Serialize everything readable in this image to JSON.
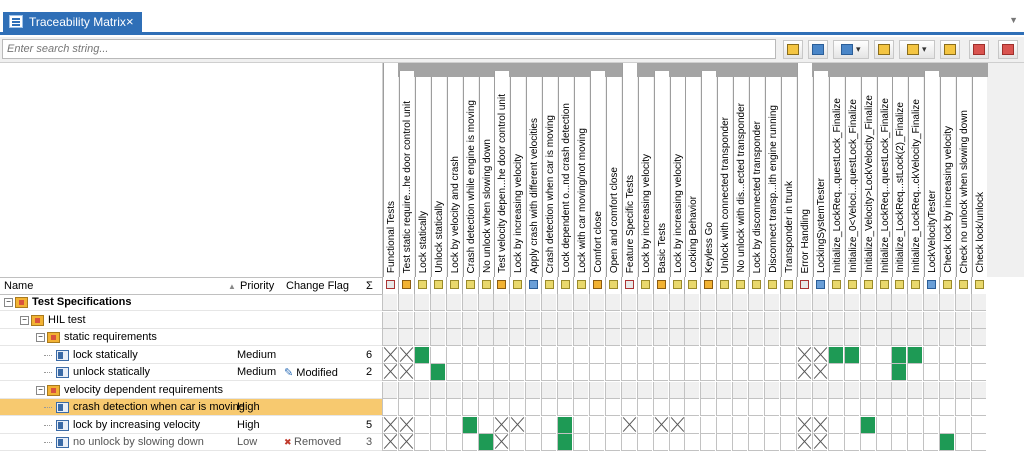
{
  "tab": {
    "title": "Traceability Matrix",
    "close": "×",
    "menu": "▼"
  },
  "search": {
    "placeholder": "Enter search string..."
  },
  "toolbar": [
    {
      "name": "search-next-button",
      "icon": "search-forward-icon"
    },
    {
      "name": "search-prev-button",
      "icon": "search-back-icon"
    },
    {
      "name": "filter-dropdown-button",
      "icon": "filter-icon"
    },
    {
      "name": "filter-apply-button",
      "icon": "filter-apply-icon"
    },
    {
      "name": "view-dropdown-button",
      "icon": "view-icon"
    },
    {
      "name": "export-button",
      "icon": "export-icon"
    },
    {
      "name": "link-button",
      "icon": "link-icon"
    },
    {
      "name": "unlink-button",
      "icon": "unlink-icon"
    }
  ],
  "columns_header": {
    "name": "Name",
    "sort_indicator": "▲",
    "priority": "Priority",
    "change_flag": "Change Flag",
    "sigma": "Σ"
  },
  "columns": [
    {
      "label": "Functional Tests",
      "kind": "group"
    },
    {
      "label": "Test static require...he door control unit",
      "kind": "sub"
    },
    {
      "label": "Lock statically",
      "kind": "item"
    },
    {
      "label": "Unlock statically",
      "kind": "item"
    },
    {
      "label": "Lock by velocity and crash",
      "kind": "item"
    },
    {
      "label": "Crash detection while engine is moving",
      "kind": "item"
    },
    {
      "label": "No unlock when slowing down",
      "kind": "item"
    },
    {
      "label": "Test velocity depen...he door control unit",
      "kind": "sub"
    },
    {
      "label": "Lock by increasing velocity",
      "kind": "item"
    },
    {
      "label": "Apply crash with different velocities",
      "kind": "item"
    },
    {
      "label": "Crash detection when car is moving",
      "kind": "item"
    },
    {
      "label": "Lock dependent o...nd crash detection",
      "kind": "item"
    },
    {
      "label": "Lock with car moving/not moving",
      "kind": "item"
    },
    {
      "label": "Comfort close",
      "kind": "sub"
    },
    {
      "label": "Open and comfort close",
      "kind": "item"
    },
    {
      "label": "Feature Specific Tests",
      "kind": "group"
    },
    {
      "label": "Lock by increasing velocity",
      "kind": "item"
    },
    {
      "label": "Basic Tests",
      "kind": "sub"
    },
    {
      "label": "Lock by increasing velocity",
      "kind": "item"
    },
    {
      "label": "Locking Behavior",
      "kind": "item"
    },
    {
      "label": "Keyless Go",
      "kind": "sub"
    },
    {
      "label": "Unlock with connected transponder",
      "kind": "item"
    },
    {
      "label": "No unlock with dis...ected transponder",
      "kind": "item"
    },
    {
      "label": "Lock by disconnected transponder",
      "kind": "item"
    },
    {
      "label": "Disconnect transp...ith engine running",
      "kind": "item"
    },
    {
      "label": "Transponder in trunk",
      "kind": "item"
    },
    {
      "label": "Error Handling",
      "kind": "group"
    },
    {
      "label": "LockingSystemTester",
      "kind": "sub"
    },
    {
      "label": "Initialize_LockReq...questLock_Finalize",
      "kind": "item"
    },
    {
      "label": "Initialize_0<Veloci...questLock_Finalize",
      "kind": "item"
    },
    {
      "label": "Initialize_Velocity>LockVelocity_Finalize",
      "kind": "item"
    },
    {
      "label": "Initialize_LockReq...questLock_Finalize",
      "kind": "item"
    },
    {
      "label": "Initialize_LockReq...stLock(2)_Finalize",
      "kind": "item"
    },
    {
      "label": "Initialize_LockReq...ckVelocity_Finalize",
      "kind": "item"
    },
    {
      "label": "LockVelocityTester",
      "kind": "sub"
    },
    {
      "label": "Check lock by increasing velocity",
      "kind": "item"
    },
    {
      "label": "Check no unlock when slowing down",
      "kind": "item"
    },
    {
      "label": "Check lock/unlock",
      "kind": "item"
    }
  ],
  "tree": [
    {
      "label": "Test Specifications",
      "level": 0,
      "type": "folder",
      "bold": true,
      "expander": "−",
      "priority": "",
      "flag": "",
      "count": ""
    },
    {
      "label": "HIL test",
      "level": 1,
      "type": "folder",
      "bold": false,
      "expander": "−",
      "priority": "",
      "flag": "",
      "count": ""
    },
    {
      "label": "static requirements",
      "level": 2,
      "type": "folder",
      "bold": false,
      "expander": "−",
      "priority": "",
      "flag": "",
      "count": ""
    },
    {
      "label": "lock statically",
      "level": 3,
      "type": "req",
      "priority": "Medium",
      "flag": "",
      "count": "6"
    },
    {
      "label": "unlock statically",
      "level": 3,
      "type": "req",
      "priority": "Medium",
      "flag": "Modified",
      "flag_icon": "pencil-icon",
      "count": "2"
    },
    {
      "label": "velocity dependent requirements",
      "level": 2,
      "type": "folder",
      "bold": false,
      "expander": "−",
      "priority": "",
      "flag": "",
      "count": ""
    },
    {
      "label": "crash detection when car is moving",
      "level": 3,
      "type": "req",
      "priority": "High",
      "flag": "",
      "count": "",
      "selected": true
    },
    {
      "label": "lock by increasing velocity",
      "level": 3,
      "type": "req",
      "priority": "High",
      "flag": "",
      "count": "5"
    },
    {
      "label": "no unlock by slowing down",
      "level": 3,
      "type": "req",
      "priority": "Low",
      "flag": "Removed",
      "flag_icon": "red-x-icon",
      "count": "3",
      "gray": true
    }
  ],
  "links": {
    "3": [
      2,
      28,
      29,
      32,
      33
    ],
    "4": [
      3,
      32
    ],
    "6": [],
    "7": [
      5,
      11,
      30
    ],
    "8": [
      6,
      11,
      35
    ]
  },
  "crossed": {
    "3": [
      0,
      1,
      26,
      27
    ],
    "4": [
      0,
      1,
      26,
      27
    ],
    "6": [],
    "7": [
      0,
      1,
      7,
      8,
      15,
      17,
      18,
      26,
      27
    ],
    "8": [
      0,
      1,
      7,
      26,
      27
    ]
  },
  "colors": {
    "accent": "#2f6fb7",
    "selected_row": "#f7c96f",
    "link": "#1e9a55",
    "removed": "#c0392b"
  }
}
